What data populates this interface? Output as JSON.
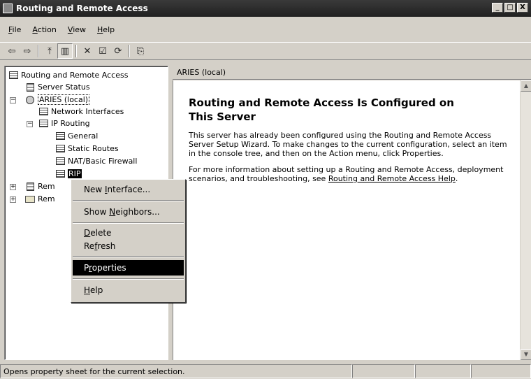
{
  "window": {
    "title": "Routing and Remote Access",
    "buttons": [
      "_",
      "□",
      "X"
    ]
  },
  "menubar": [
    {
      "pre": "",
      "key": "F",
      "post": "ile"
    },
    {
      "pre": "",
      "key": "A",
      "post": "ction"
    },
    {
      "pre": "",
      "key": "V",
      "post": "iew"
    },
    {
      "pre": "",
      "key": "H",
      "post": "elp"
    }
  ],
  "toolbar": {
    "icons": [
      "back-icon",
      "forward-icon",
      "up-level-icon",
      "show-hide-tree-icon",
      "delete-icon",
      "properties-icon",
      "refresh-icon",
      "export-list-icon"
    ],
    "glyphs": {
      "back": "⇦",
      "forward": "⇨",
      "up": "⤒",
      "tree": "▥",
      "delete": "✕",
      "properties": "☑",
      "refresh": "⟳",
      "export": "⎘"
    }
  },
  "tree": {
    "root": "Routing and Remote Access",
    "server_status": "Server Status",
    "server": "ARIES (local)",
    "network_interfaces": "Network Interfaces",
    "ip_routing": "IP Routing",
    "general": "General",
    "static_routes": "Static Routes",
    "nat": "NAT/Basic Firewall",
    "rip": "RIP",
    "remote_access_policies": "Rem",
    "remote_access_logging": "Rem",
    "expander_minus": "−",
    "expander_plus": "+"
  },
  "right_pane": {
    "header": "ARIES (local)",
    "heading": "Routing and Remote Access Is Configured on This Server",
    "para1": "This server has already been configured using the Routing and Remote Access Server Setup Wizard. To make changes to the current configuration, select an item in the console tree, and then on the Action menu, click Properties.",
    "para2_prefix": "For more information about setting up a Routing and Remote Access, deployment scenarios, and troubleshooting, see ",
    "help_link": "Routing and Remote Access Help",
    "para2_suffix": ".",
    "scroll_up": "▲",
    "scroll_down": "▼"
  },
  "context_menu": {
    "new_interface": {
      "pre": "New ",
      "key": "I",
      "post": "nterface..."
    },
    "show_neighbors": {
      "pre": "Show ",
      "key": "N",
      "post": "eighbors..."
    },
    "delete": {
      "pre": "",
      "key": "D",
      "post": "elete"
    },
    "refresh": {
      "pre": "Re",
      "key": "f",
      "post": "resh"
    },
    "properties": {
      "pre": "P",
      "key": "r",
      "post": "operties"
    },
    "help": {
      "pre": "",
      "key": "H",
      "post": "elp"
    }
  },
  "statusbar": {
    "text": "Opens property sheet for the current selection."
  }
}
